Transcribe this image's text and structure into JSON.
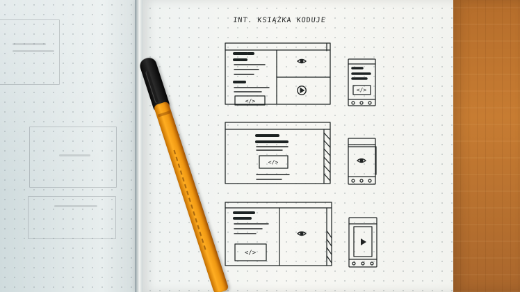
{
  "notebook": {
    "title": "INT. KSIĄŻKA KODUJE"
  },
  "icons": {
    "eye": "eye-icon",
    "play": "play-icon",
    "code": "code-icon"
  },
  "colors": {
    "ink": "#1f2222",
    "paper": "#f6f6f1",
    "pen_orange": "#f59e16",
    "pen_black": "#111111",
    "desk_wood": "#c77c32"
  },
  "code_label": "</>"
}
